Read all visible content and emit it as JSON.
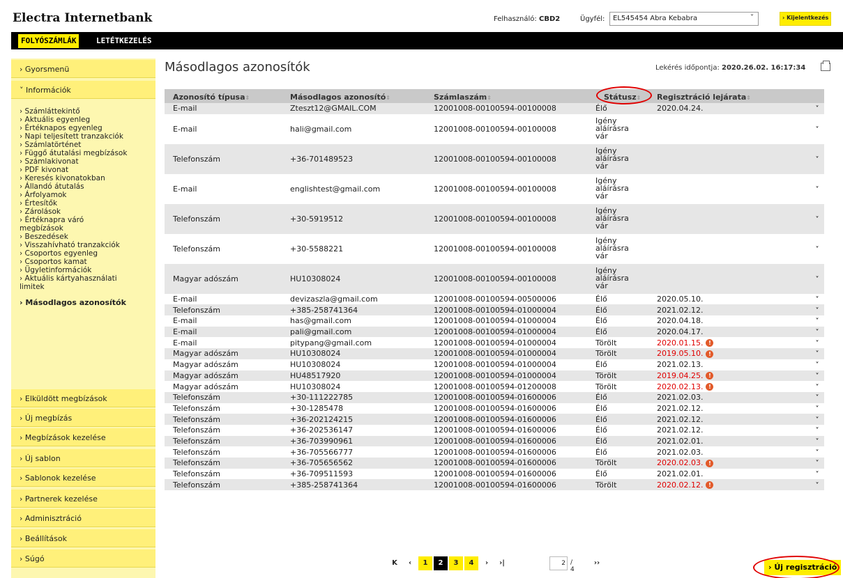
{
  "header": {
    "app_title": "Electra Internetbank",
    "user_label": "Felhasználó:",
    "user_value": "CBD2",
    "client_label": "Ügyfél:",
    "client_value": "EL545454 Abra Kebabra",
    "logout": "› Kijelentkezés"
  },
  "nav": {
    "tab1": "FOLYÓSZÁMLÁK",
    "tab2": "LETÉTKEZELÉS"
  },
  "sidebar": {
    "gyorsmenu": "› Gyorsmenü",
    "informaciok": "˅ Információk",
    "sub": [
      "› Számláttekintő",
      "› Aktuális egyenleg",
      "› Értéknapos egyenleg",
      "› Napi teljesített tranzakciók",
      "› Számlatörténet",
      "› Függő átutalási megbízások",
      "› Számlakivonat",
      "› PDF kivonat",
      "› Keresés kivonatokban",
      "› Állandó átutalás",
      "› Árfolyamok",
      "› Értesítők",
      "› Zárolások",
      "› Értéknapra váró",
      "megbízások",
      "› Beszedések",
      "› Visszahívható tranzakciók",
      "› Csoportos egyenleg",
      "› Csoportos kamat",
      "› Ügyletinformációk",
      "› Aktuális kártyahasználati",
      "limitek",
      "› Másodlagos azonosítók"
    ],
    "bottom": [
      "› Elküldött megbízások",
      "› Új megbízás",
      "› Megbízások kezelése",
      "› Új sablon",
      "› Sablonok kezelése",
      "› Partnerek kezelése",
      "› Adminisztráció",
      "› Beállítások",
      "› Súgó"
    ]
  },
  "main": {
    "title": "Másodlagos azonosítók",
    "query_label": "Lekérés időpontja:",
    "query_value": "2020.26.02. 16:17:34"
  },
  "table": {
    "headers": [
      "Azonosító típusa",
      "Másodlagos azonosító",
      "Számlaszám",
      "Státusz",
      "Regisztráció lejárata"
    ],
    "rows": [
      [
        "E-mail",
        "Zteszt12@GMAIL.COM",
        "12001008-00100594-00100008",
        "Élő",
        "2020.04.24.",
        false
      ],
      [
        "E-mail",
        "hali@gmail.com",
        "12001008-00100594-00100008",
        "Igény aláírásra vár",
        "",
        false
      ],
      [
        "Telefonszám",
        "+36-701489523",
        "12001008-00100594-00100008",
        "Igény aláírásra vár",
        "",
        false
      ],
      [
        "E-mail",
        "englishtest@gmail.com",
        "12001008-00100594-00100008",
        "Igény aláírásra vár",
        "",
        false
      ],
      [
        "Telefonszám",
        "+30-5919512",
        "12001008-00100594-00100008",
        "Igény aláírásra vár",
        "",
        false
      ],
      [
        "Telefonszám",
        "+30-5588221",
        "12001008-00100594-00100008",
        "Igény aláírásra vár",
        "",
        false
      ],
      [
        "Magyar adószám",
        "HU10308024",
        "12001008-00100594-00100008",
        "Igény aláírásra vár",
        "",
        false
      ],
      [
        "E-mail",
        "devizaszla@gmail.com",
        "12001008-00100594-00500006",
        "Élő",
        "2020.05.10.",
        false
      ],
      [
        "Telefonszám",
        "+385-258741364",
        "12001008-00100594-01000004",
        "Élő",
        "2021.02.12.",
        false
      ],
      [
        "E-mail",
        "has@gmail.com",
        "12001008-00100594-01000004",
        "Élő",
        "2020.04.18.",
        false
      ],
      [
        "E-mail",
        "pali@gmail.com",
        "12001008-00100594-01000004",
        "Élő",
        "2020.04.17.",
        false
      ],
      [
        "E-mail",
        "pitypang@gmail.com",
        "12001008-00100594-01000004",
        "Törölt",
        "2020.01.15.",
        true
      ],
      [
        "Magyar adószám",
        "HU10308024",
        "12001008-00100594-01000004",
        "Törölt",
        "2019.05.10.",
        true
      ],
      [
        "Magyar adószám",
        "HU10308024",
        "12001008-00100594-01000004",
        "Élő",
        "2021.02.13.",
        false
      ],
      [
        "Magyar adószám",
        "HU48517920",
        "12001008-00100594-01000004",
        "Törölt",
        "2019.04.25.",
        true
      ],
      [
        "Magyar adószám",
        "HU10308024",
        "12001008-00100594-01200008",
        "Törölt",
        "2020.02.13.",
        true
      ],
      [
        "Telefonszám",
        "+30-111222785",
        "12001008-00100594-01600006",
        "Élő",
        "2021.02.03.",
        false
      ],
      [
        "Telefonszám",
        "+30-1285478",
        "12001008-00100594-01600006",
        "Élő",
        "2021.02.12.",
        false
      ],
      [
        "Telefonszám",
        "+36-202124215",
        "12001008-00100594-01600006",
        "Élő",
        "2021.02.12.",
        false
      ],
      [
        "Telefonszám",
        "+36-202536147",
        "12001008-00100594-01600006",
        "Élő",
        "2021.02.12.",
        false
      ],
      [
        "Telefonszám",
        "+36-703990961",
        "12001008-00100594-01600006",
        "Élő",
        "2021.02.01.",
        false
      ],
      [
        "Telefonszám",
        "+36-705566777",
        "12001008-00100594-01600006",
        "Élő",
        "2021.02.03.",
        false
      ],
      [
        "Telefonszám",
        "+36-705656562",
        "12001008-00100594-01600006",
        "Törölt",
        "2020.02.03.",
        true
      ],
      [
        "Telefonszám",
        "+36-709511593",
        "12001008-00100594-01600006",
        "Élő",
        "2021.02.01.",
        false
      ],
      [
        "Telefonszám",
        "+385-258741364",
        "12001008-00100594-01600006",
        "Törölt",
        "2020.02.12.",
        true
      ]
    ]
  },
  "pager": {
    "pages": [
      "1",
      "2",
      "3",
      "4"
    ],
    "current": "2",
    "page_input": "2",
    "total": "/ 4"
  },
  "new_registration": "› Új regisztráció",
  "colors": {
    "brand_yellow": "#ffed00",
    "warning_red": "#e00000"
  }
}
